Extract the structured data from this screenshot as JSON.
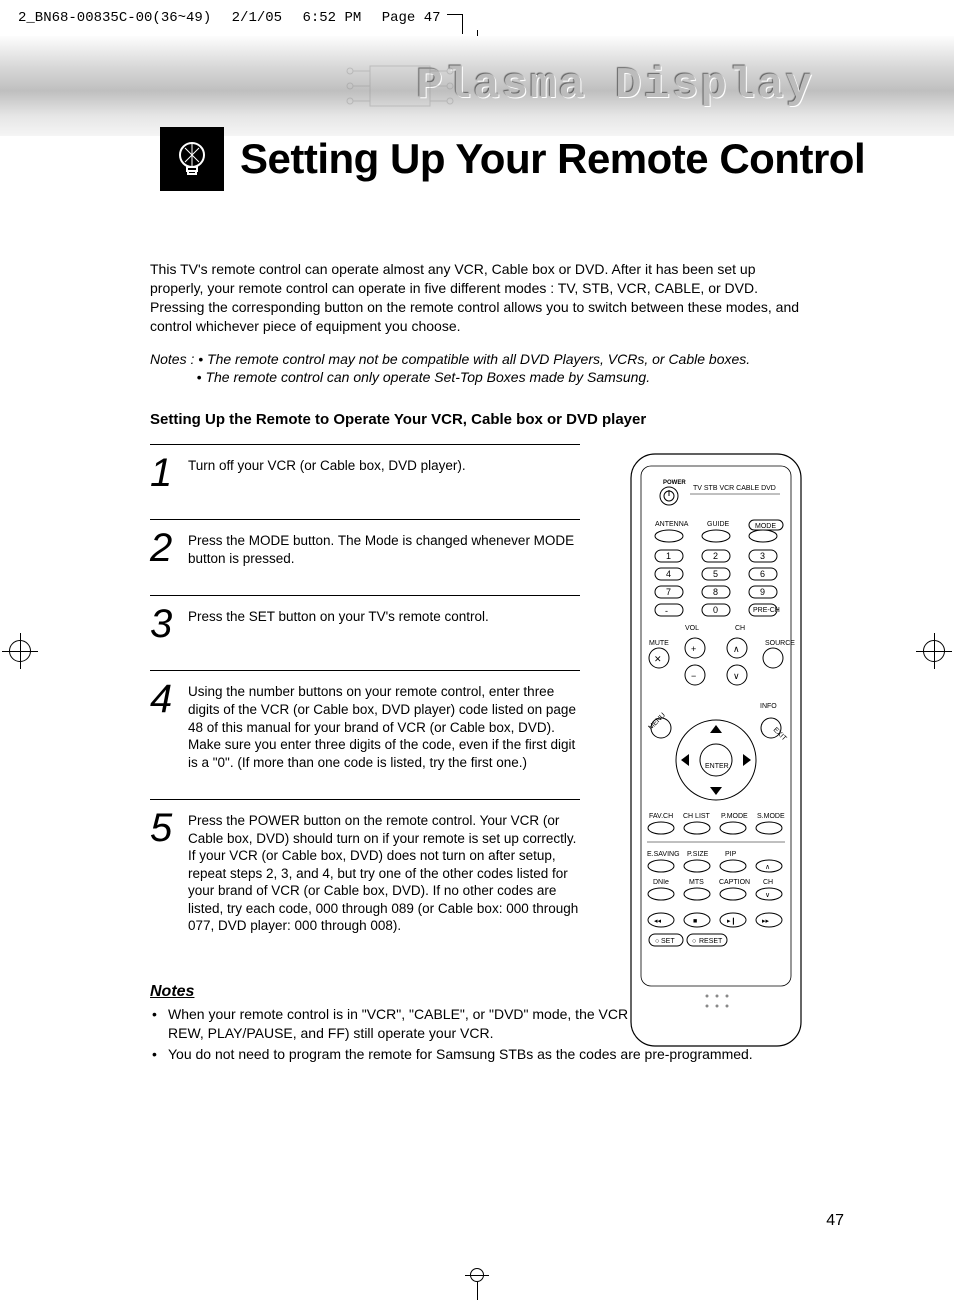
{
  "print_marks": {
    "filename": "2_BN68-00835C-00(36~49)",
    "date": "2/1/05",
    "time": "6:52 PM",
    "page_label": "Page 47"
  },
  "header": {
    "display_brand": "Plasma Display",
    "title": "Setting Up Your Remote Control",
    "icon": "lightbulb-icon"
  },
  "intro": "This TV's remote control can operate almost any VCR, Cable box or DVD. After it has been set up properly, your remote control can operate in five different modes : TV, STB, VCR, CABLE, or DVD. Pressing the corresponding button on the remote control allows you to switch between these modes, and control whichever piece of equipment you choose.",
  "inline_notes": {
    "label": "Notes :",
    "items": [
      "The remote control may not be compatible with all DVD Players, VCRs, or Cable boxes.",
      "The remote control can only operate Set-Top Boxes made by Samsung."
    ]
  },
  "subhead": "Setting Up the Remote to Operate Your VCR, Cable box or DVD player",
  "steps": [
    {
      "n": "1",
      "text": "Turn off your VCR (or Cable box, DVD player)."
    },
    {
      "n": "2",
      "text": "Press the MODE button. The Mode is changed whenever MODE button is pressed."
    },
    {
      "n": "3",
      "text": "Press the SET button on your TV's remote control."
    },
    {
      "n": "4",
      "text": "Using the number buttons on your remote control, enter three digits of the VCR (or Cable box, DVD player) code listed on page 48 of this manual for your brand of VCR (or Cable box, DVD). Make sure you enter three digits of the code, even if the first digit is a \"0\". (If more than one code is listed, try the first one.)"
    },
    {
      "n": "5",
      "text": "Press the POWER button on the remote control. Your VCR (or Cable box, DVD) should turn on if your remote is set up correctly. If your VCR (or Cable box, DVD) does not turn on after setup, repeat steps 2, 3, and 4, but try one of the other codes listed for your brand of VCR (or Cable box, DVD). If no other codes are listed, try each code, 000 through 089 (or Cable box: 000 through 077, DVD player: 000 through 008)."
    }
  ],
  "notes_section": {
    "heading": "Notes",
    "items": [
      "When your remote control is in \"VCR\", \"CABLE\", or \"DVD\" mode, the VCR control buttons (STOP, REW, PLAY/PAUSE, and FF) still operate your VCR.",
      "You do not need to program the remote for Samsung STBs as the codes are pre-programmed."
    ]
  },
  "page_number": "47",
  "remote": {
    "power": "POWER",
    "modes": "TV  STB  VCR  CABLE  DVD",
    "row_labels": {
      "antenna": "ANTENNA",
      "guide": "GUIDE",
      "mode": "MODE"
    },
    "keypad": [
      "1",
      "2",
      "3",
      "4",
      "5",
      "6",
      "7",
      "8",
      "9",
      "-",
      "0",
      "PRE-CH"
    ],
    "vol": "VOL",
    "ch": "CH",
    "mute": "MUTE",
    "source": "SOURCE",
    "info": "INFO",
    "menu": "MENU",
    "exit": "EXIT",
    "enter": "ENTER",
    "bottom_row1": [
      "FAV.CH",
      "CH LIST",
      "P.MODE",
      "S.MODE"
    ],
    "bottom_row2": [
      "E.SAVING",
      "P.SIZE",
      "PIP",
      ""
    ],
    "bottom_row3": [
      "DNIe",
      "MTS",
      "CAPTION",
      "CH"
    ],
    "set": "SET",
    "reset": "RESET"
  }
}
